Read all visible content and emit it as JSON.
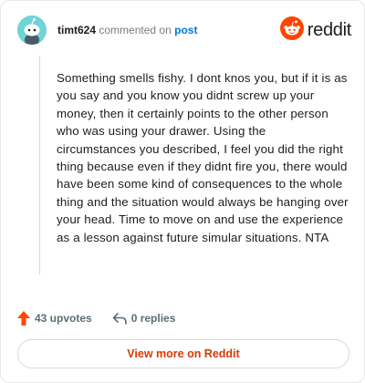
{
  "header": {
    "username": "timt624",
    "action_text": "commented on",
    "post_link": "post",
    "brand_name": "reddit"
  },
  "comment": {
    "body": "Something smells fishy. I dont knos you, but if it is as you say and you know you didnt screw up your money, then it certainly points to the other person who was using your drawer. Using the circumstances you described, I feel you did the right thing because even if they didnt fire you, there would have been some kind of consequences to the whole thing and the situation would always be hanging over your head. Time to move on and use the experience as a lesson against future simular situations. NTA"
  },
  "footer": {
    "upvotes": "43 upvotes",
    "replies": "0 replies",
    "view_more": "View more on Reddit"
  },
  "colors": {
    "reddit_orange": "#ff4500",
    "view_more_text": "#d93a00",
    "post_link": "#0079d3",
    "avatar_bg": "#6fd3d8"
  },
  "icons": [
    "snoo-avatar-icon",
    "reddit-logo-icon",
    "upvote-arrow-icon",
    "reply-arrow-icon"
  ]
}
